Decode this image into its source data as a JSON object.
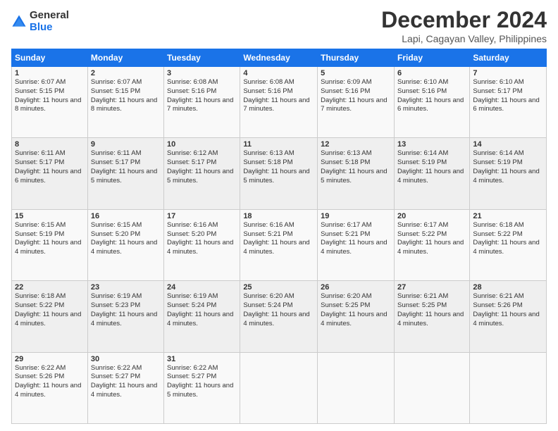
{
  "header": {
    "logo_general": "General",
    "logo_blue": "Blue",
    "title": "December 2024",
    "subtitle": "Lapi, Cagayan Valley, Philippines"
  },
  "days_of_week": [
    "Sunday",
    "Monday",
    "Tuesday",
    "Wednesday",
    "Thursday",
    "Friday",
    "Saturday"
  ],
  "weeks": [
    [
      {
        "day": "1",
        "sunrise": "Sunrise: 6:07 AM",
        "sunset": "Sunset: 5:15 PM",
        "daylight": "Daylight: 11 hours and 8 minutes."
      },
      {
        "day": "2",
        "sunrise": "Sunrise: 6:07 AM",
        "sunset": "Sunset: 5:15 PM",
        "daylight": "Daylight: 11 hours and 8 minutes."
      },
      {
        "day": "3",
        "sunrise": "Sunrise: 6:08 AM",
        "sunset": "Sunset: 5:16 PM",
        "daylight": "Daylight: 11 hours and 7 minutes."
      },
      {
        "day": "4",
        "sunrise": "Sunrise: 6:08 AM",
        "sunset": "Sunset: 5:16 PM",
        "daylight": "Daylight: 11 hours and 7 minutes."
      },
      {
        "day": "5",
        "sunrise": "Sunrise: 6:09 AM",
        "sunset": "Sunset: 5:16 PM",
        "daylight": "Daylight: 11 hours and 7 minutes."
      },
      {
        "day": "6",
        "sunrise": "Sunrise: 6:10 AM",
        "sunset": "Sunset: 5:16 PM",
        "daylight": "Daylight: 11 hours and 6 minutes."
      },
      {
        "day": "7",
        "sunrise": "Sunrise: 6:10 AM",
        "sunset": "Sunset: 5:17 PM",
        "daylight": "Daylight: 11 hours and 6 minutes."
      }
    ],
    [
      {
        "day": "8",
        "sunrise": "Sunrise: 6:11 AM",
        "sunset": "Sunset: 5:17 PM",
        "daylight": "Daylight: 11 hours and 6 minutes."
      },
      {
        "day": "9",
        "sunrise": "Sunrise: 6:11 AM",
        "sunset": "Sunset: 5:17 PM",
        "daylight": "Daylight: 11 hours and 5 minutes."
      },
      {
        "day": "10",
        "sunrise": "Sunrise: 6:12 AM",
        "sunset": "Sunset: 5:17 PM",
        "daylight": "Daylight: 11 hours and 5 minutes."
      },
      {
        "day": "11",
        "sunrise": "Sunrise: 6:13 AM",
        "sunset": "Sunset: 5:18 PM",
        "daylight": "Daylight: 11 hours and 5 minutes."
      },
      {
        "day": "12",
        "sunrise": "Sunrise: 6:13 AM",
        "sunset": "Sunset: 5:18 PM",
        "daylight": "Daylight: 11 hours and 5 minutes."
      },
      {
        "day": "13",
        "sunrise": "Sunrise: 6:14 AM",
        "sunset": "Sunset: 5:19 PM",
        "daylight": "Daylight: 11 hours and 4 minutes."
      },
      {
        "day": "14",
        "sunrise": "Sunrise: 6:14 AM",
        "sunset": "Sunset: 5:19 PM",
        "daylight": "Daylight: 11 hours and 4 minutes."
      }
    ],
    [
      {
        "day": "15",
        "sunrise": "Sunrise: 6:15 AM",
        "sunset": "Sunset: 5:19 PM",
        "daylight": "Daylight: 11 hours and 4 minutes."
      },
      {
        "day": "16",
        "sunrise": "Sunrise: 6:15 AM",
        "sunset": "Sunset: 5:20 PM",
        "daylight": "Daylight: 11 hours and 4 minutes."
      },
      {
        "day": "17",
        "sunrise": "Sunrise: 6:16 AM",
        "sunset": "Sunset: 5:20 PM",
        "daylight": "Daylight: 11 hours and 4 minutes."
      },
      {
        "day": "18",
        "sunrise": "Sunrise: 6:16 AM",
        "sunset": "Sunset: 5:21 PM",
        "daylight": "Daylight: 11 hours and 4 minutes."
      },
      {
        "day": "19",
        "sunrise": "Sunrise: 6:17 AM",
        "sunset": "Sunset: 5:21 PM",
        "daylight": "Daylight: 11 hours and 4 minutes."
      },
      {
        "day": "20",
        "sunrise": "Sunrise: 6:17 AM",
        "sunset": "Sunset: 5:22 PM",
        "daylight": "Daylight: 11 hours and 4 minutes."
      },
      {
        "day": "21",
        "sunrise": "Sunrise: 6:18 AM",
        "sunset": "Sunset: 5:22 PM",
        "daylight": "Daylight: 11 hours and 4 minutes."
      }
    ],
    [
      {
        "day": "22",
        "sunrise": "Sunrise: 6:18 AM",
        "sunset": "Sunset: 5:22 PM",
        "daylight": "Daylight: 11 hours and 4 minutes."
      },
      {
        "day": "23",
        "sunrise": "Sunrise: 6:19 AM",
        "sunset": "Sunset: 5:23 PM",
        "daylight": "Daylight: 11 hours and 4 minutes."
      },
      {
        "day": "24",
        "sunrise": "Sunrise: 6:19 AM",
        "sunset": "Sunset: 5:24 PM",
        "daylight": "Daylight: 11 hours and 4 minutes."
      },
      {
        "day": "25",
        "sunrise": "Sunrise: 6:20 AM",
        "sunset": "Sunset: 5:24 PM",
        "daylight": "Daylight: 11 hours and 4 minutes."
      },
      {
        "day": "26",
        "sunrise": "Sunrise: 6:20 AM",
        "sunset": "Sunset: 5:25 PM",
        "daylight": "Daylight: 11 hours and 4 minutes."
      },
      {
        "day": "27",
        "sunrise": "Sunrise: 6:21 AM",
        "sunset": "Sunset: 5:25 PM",
        "daylight": "Daylight: 11 hours and 4 minutes."
      },
      {
        "day": "28",
        "sunrise": "Sunrise: 6:21 AM",
        "sunset": "Sunset: 5:26 PM",
        "daylight": "Daylight: 11 hours and 4 minutes."
      }
    ],
    [
      {
        "day": "29",
        "sunrise": "Sunrise: 6:22 AM",
        "sunset": "Sunset: 5:26 PM",
        "daylight": "Daylight: 11 hours and 4 minutes."
      },
      {
        "day": "30",
        "sunrise": "Sunrise: 6:22 AM",
        "sunset": "Sunset: 5:27 PM",
        "daylight": "Daylight: 11 hours and 4 minutes."
      },
      {
        "day": "31",
        "sunrise": "Sunrise: 6:22 AM",
        "sunset": "Sunset: 5:27 PM",
        "daylight": "Daylight: 11 hours and 5 minutes."
      },
      null,
      null,
      null,
      null
    ]
  ]
}
